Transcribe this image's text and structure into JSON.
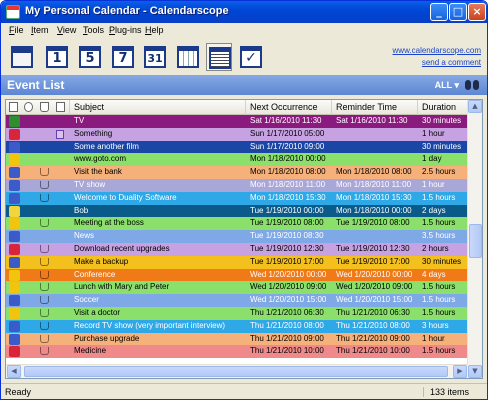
{
  "window": {
    "title": "My Personal Calendar - Calendarscope"
  },
  "menu": [
    "File",
    "Item",
    "View",
    "Tools",
    "Plug-ins",
    "Help"
  ],
  "toolbar": {
    "tools": [
      {
        "name": "tool-overview",
        "label": ""
      },
      {
        "name": "tool-day-view",
        "label": "1"
      },
      {
        "name": "tool-workweek-view",
        "label": "5"
      },
      {
        "name": "tool-week-view",
        "label": "7"
      },
      {
        "name": "tool-month-view",
        "label": "31"
      },
      {
        "name": "tool-year-view",
        "label": ""
      },
      {
        "name": "tool-event-list",
        "label": ""
      },
      {
        "name": "tool-task-list",
        "label": ""
      }
    ],
    "website_link": "www.calendarscope.com",
    "comment_link": "send a comment"
  },
  "event_list": {
    "title": "Event List",
    "filter": "ALL"
  },
  "columns": {
    "subject": "Subject",
    "next": "Next Occurrence",
    "reminder": "Reminder Time",
    "duration": "Duration"
  },
  "rows": [
    {
      "subject": "TV",
      "next": "Sat 1/16/2010 11:30",
      "reminder": "Sat 1/16/2010 11:30",
      "duration": "30 minutes",
      "bg": "#8b1a7e",
      "fg": "#ffffff",
      "icon": "phone-icon",
      "icon_color": "#2f8f2f",
      "attach": false,
      "notes": false
    },
    {
      "subject": "Something",
      "next": "Sun 1/17/2010 05:00",
      "reminder": "",
      "duration": "1 hour",
      "bg": "#c7a2e3",
      "fg": "#000000",
      "icon": "rescue-icon",
      "icon_color": "#d8253a",
      "attach": false,
      "notes": true
    },
    {
      "subject": "Some another film",
      "next": "Sun 1/17/2010 09:00",
      "reminder": "",
      "duration": "30 minutes",
      "bg": "#1a47a6",
      "fg": "#ffffff",
      "icon": "tv-icon",
      "icon_color": "#3a5bc8",
      "attach": false,
      "notes": false
    },
    {
      "subject": "www.goto.com",
      "next": "Mon 1/18/2010 00:00",
      "reminder": "",
      "duration": "1 day",
      "bg": "#8ae06b",
      "fg": "#000000",
      "icon": "clock-icon",
      "icon_color": "#f1c40f",
      "attach": false,
      "notes": false
    },
    {
      "subject": "Visit the bank",
      "next": "Mon 1/18/2010 08:00",
      "reminder": "Mon 1/18/2010 08:00",
      "duration": "2.5 hours",
      "bg": "#f6b07a",
      "fg": "#000000",
      "icon": "sparkle-icon",
      "icon_color": "#3a5bc8",
      "attach": true,
      "notes": false
    },
    {
      "subject": "TV show",
      "next": "Mon 1/18/2010 11:00",
      "reminder": "Mon 1/18/2010 11:00",
      "duration": "1 hour",
      "bg": "#a9a6d8",
      "fg": "#ffffff",
      "icon": "tv-icon",
      "icon_color": "#3a5bc8",
      "attach": true,
      "notes": false
    },
    {
      "subject": "Welcome to Duality Software",
      "next": "Mon 1/18/2010 15:30",
      "reminder": "Mon 1/18/2010 15:30",
      "duration": "1.5 hours",
      "bg": "#2ea8e6",
      "fg": "#ffffff",
      "icon": "sparkle-icon",
      "icon_color": "#3a5bc8",
      "attach": true,
      "notes": false
    },
    {
      "subject": "Bob",
      "next": "Tue 1/19/2010 00:00",
      "reminder": "Mon 1/18/2010 00:00",
      "duration": "2 days",
      "bg": "#0b5b8a",
      "fg": "#ffffff",
      "icon": "bulb-icon",
      "icon_color": "#f3d43a",
      "attach": false,
      "notes": false
    },
    {
      "subject": "Meeting at the boss",
      "next": "Tue 1/19/2010 08:00",
      "reminder": "Tue 1/19/2010 08:00",
      "duration": "1.5 hours",
      "bg": "#8ae06b",
      "fg": "#000000",
      "icon": "clock-icon",
      "icon_color": "#f1c40f",
      "attach": true,
      "notes": false
    },
    {
      "subject": "News",
      "next": "Tue 1/19/2010 08:30",
      "reminder": "",
      "duration": "3.5 hours",
      "bg": "#7fa9e6",
      "fg": "#ffffff",
      "icon": "tv-icon",
      "icon_color": "#3a5bc8",
      "attach": false,
      "notes": false
    },
    {
      "subject": "Download recent upgrades",
      "next": "Tue 1/19/2010 12:30",
      "reminder": "Tue 1/19/2010 12:30",
      "duration": "2 hours",
      "bg": "#c7a2e3",
      "fg": "#000000",
      "icon": "rescue-icon",
      "icon_color": "#d8253a",
      "attach": true,
      "notes": false
    },
    {
      "subject": "Make a backup",
      "next": "Tue 1/19/2010 17:00",
      "reminder": "Tue 1/19/2010 17:00",
      "duration": "30 minutes",
      "bg": "#f3c01e",
      "fg": "#000000",
      "icon": "sparkle-icon",
      "icon_color": "#3a5bc8",
      "attach": true,
      "notes": false
    },
    {
      "subject": "Conference",
      "next": "Wed 1/20/2010 00:00",
      "reminder": "Wed 1/20/2010 00:00",
      "duration": "4 days",
      "bg": "#f07a17",
      "fg": "#ffffff",
      "icon": "warning-icon",
      "icon_color": "#f1c40f",
      "attach": true,
      "notes": false
    },
    {
      "subject": "Lunch with Mary and Peter",
      "next": "Wed 1/20/2010 09:00",
      "reminder": "Wed 1/20/2010 09:00",
      "duration": "1.5 hours",
      "bg": "#8ae06b",
      "fg": "#000000",
      "icon": "clock-icon",
      "icon_color": "#f1c40f",
      "attach": true,
      "notes": false
    },
    {
      "subject": "Soccer",
      "next": "Wed 1/20/2010 15:00",
      "reminder": "Wed 1/20/2010 15:00",
      "duration": "1.5 hours",
      "bg": "#7fa9e6",
      "fg": "#ffffff",
      "icon": "tv-icon",
      "icon_color": "#3a5bc8",
      "attach": true,
      "notes": false
    },
    {
      "subject": "Visit a doctor",
      "next": "Thu 1/21/2010 06:30",
      "reminder": "Thu 1/21/2010 06:30",
      "duration": "1.5 hours",
      "bg": "#8ae06b",
      "fg": "#000000",
      "icon": "clock-icon",
      "icon_color": "#f1c40f",
      "attach": true,
      "notes": false
    },
    {
      "subject": "Record TV show (very important interview)",
      "next": "Thu 1/21/2010 08:00",
      "reminder": "Thu 1/21/2010 08:00",
      "duration": "3 hours",
      "bg": "#2ea8e6",
      "fg": "#ffffff",
      "icon": "tv-icon",
      "icon_color": "#3a5bc8",
      "attach": true,
      "notes": false
    },
    {
      "subject": "Purchase upgrade",
      "next": "Thu 1/21/2010 09:00",
      "reminder": "Thu 1/21/2010 09:00",
      "duration": "1 hour",
      "bg": "#f6b07a",
      "fg": "#000000",
      "icon": "sparkle-icon",
      "icon_color": "#3a5bc8",
      "attach": true,
      "notes": false
    },
    {
      "subject": "Medicine",
      "next": "Thu 1/21/2010 10:00",
      "reminder": "Thu 1/21/2010 10:00",
      "duration": "1.5 hours",
      "bg": "#f08a8a",
      "fg": "#000000",
      "icon": "medical-icon",
      "icon_color": "#d8253a",
      "attach": true,
      "notes": false
    }
  ],
  "status": {
    "left": "Ready",
    "right": "133 items"
  }
}
